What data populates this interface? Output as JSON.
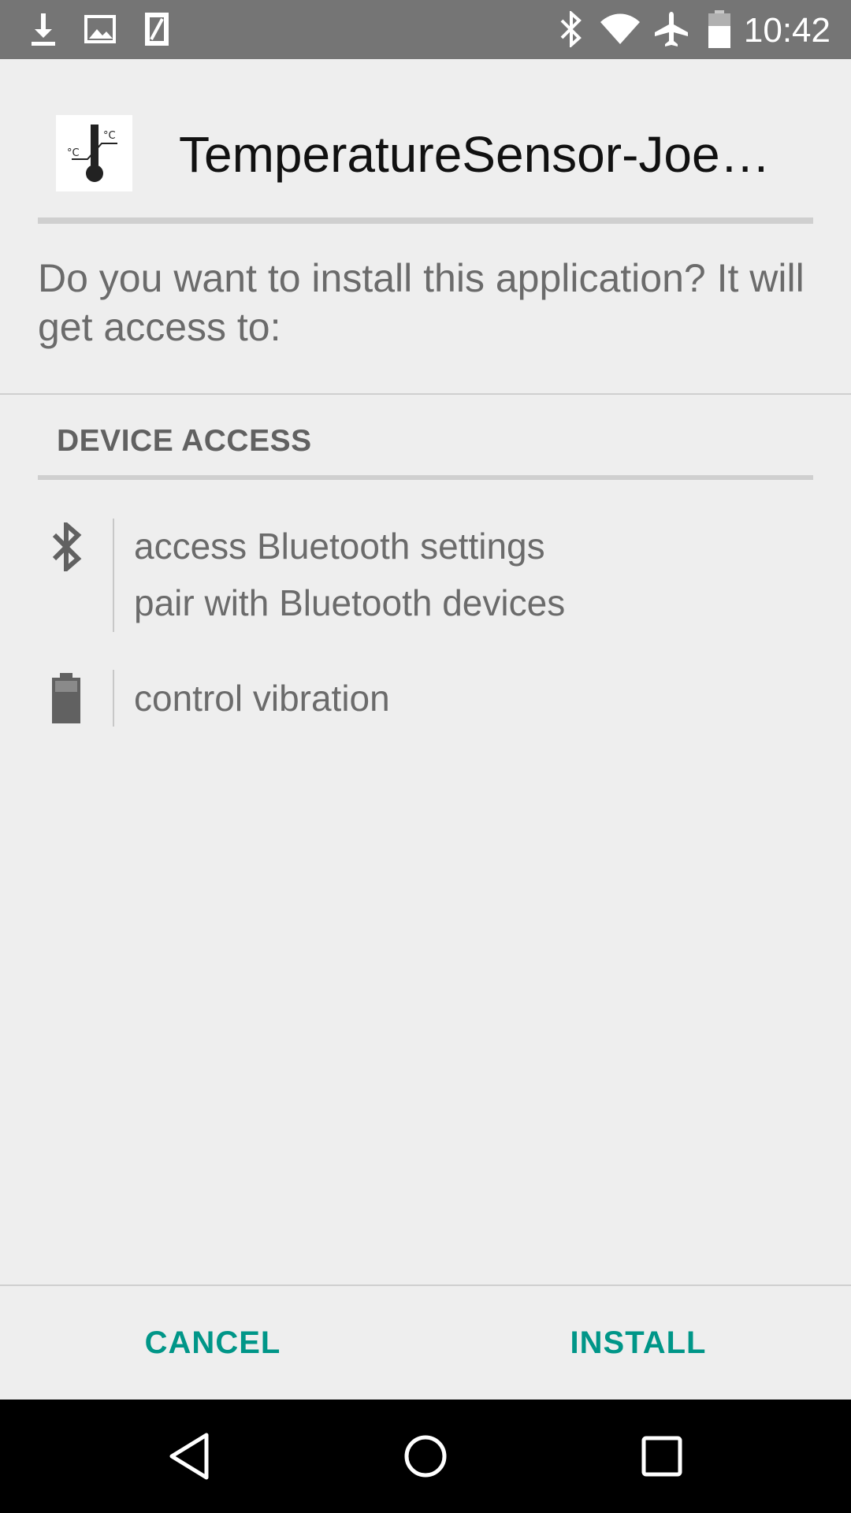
{
  "status_bar": {
    "time": "10:42",
    "left_icons": [
      "download-icon",
      "image-icon",
      "sd-card-icon"
    ],
    "right_icons": [
      "bluetooth-icon",
      "wifi-icon",
      "airplane-icon",
      "battery-icon"
    ]
  },
  "app": {
    "icon": "thermometer-icon",
    "name": "TemperatureSensor-Joe…"
  },
  "prompt": {
    "question": "Do you want to install this application? It will get access to:"
  },
  "permissions": {
    "section_title": "DEVICE ACCESS",
    "groups": [
      {
        "icon": "bluetooth-icon",
        "items": [
          "access Bluetooth settings",
          "pair with Bluetooth devices"
        ]
      },
      {
        "icon": "battery-icon",
        "items": [
          "control vibration"
        ]
      }
    ]
  },
  "actions": {
    "cancel_label": "CANCEL",
    "install_label": "INSTALL"
  },
  "navigation": {
    "buttons": [
      "back-icon",
      "home-icon",
      "recents-icon"
    ]
  },
  "colors": {
    "accent": "#009688",
    "status_bar": "#757575",
    "background": "#eeeeee",
    "nav_bar": "#000000"
  }
}
